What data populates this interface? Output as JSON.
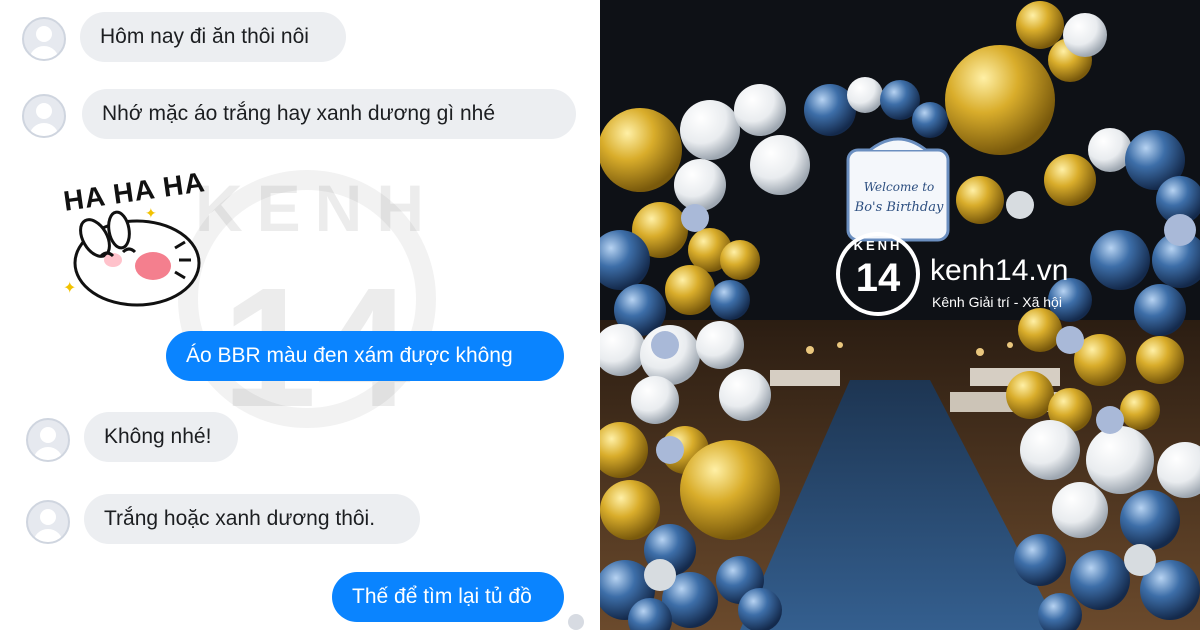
{
  "watermark": {
    "letters": "KENH",
    "number": "14"
  },
  "chat": {
    "messages": [
      {
        "id": 1,
        "side": "incoming",
        "text": "Hôm nay đi ăn thôi nôi"
      },
      {
        "id": 2,
        "side": "incoming",
        "text": "Nhớ mặc áo trắng hay xanh dương gì nhé"
      },
      {
        "id": 3,
        "side": "outgoing",
        "text": "Áo BBR màu đen xám được không"
      },
      {
        "id": 4,
        "side": "incoming",
        "text": "Không nhé!"
      },
      {
        "id": 5,
        "side": "incoming",
        "text": "Trắng hoặc xanh dương thôi."
      },
      {
        "id": 6,
        "side": "outgoing",
        "text": "Thế để tìm lại tủ đồ"
      }
    ],
    "sticker": {
      "text": "HA HA HA",
      "icon": "laughing-bunny-sticker"
    },
    "colors": {
      "incoming_bubble": "#eceef1",
      "outgoing_bubble": "#0a84ff"
    }
  },
  "photo": {
    "sign": {
      "line1": "Welcome to",
      "line2": "Bo's Birthday"
    },
    "logo": {
      "badge_top": "KENH",
      "badge_number": "14",
      "site": "kenh14.vn",
      "tagline": "Kênh Giải trí - Xã hội"
    },
    "colors": {
      "gold": "#c9a227",
      "blue": "#3d6ea8",
      "white": "#f2f2f2",
      "night": "#0e1116"
    }
  }
}
